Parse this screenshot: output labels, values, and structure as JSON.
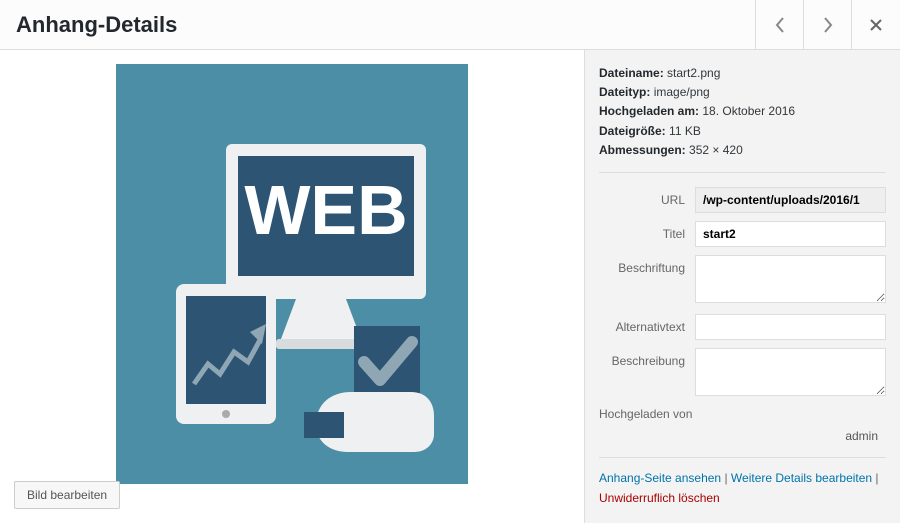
{
  "header": {
    "title": "Anhang-Details"
  },
  "edit_button": "Bild bearbeiten",
  "meta": {
    "filename_label": "Dateiname:",
    "filename_value": "start2.png",
    "filetype_label": "Dateityp:",
    "filetype_value": "image/png",
    "uploaded_on_label": "Hochgeladen am:",
    "uploaded_on_value": "18. Oktober 2016",
    "filesize_label": "Dateigröße:",
    "filesize_value": "11 KB",
    "dimensions_label": "Abmessungen:",
    "dimensions_value": "352 × 420"
  },
  "fields": {
    "url_label": "URL",
    "url_value": "/wp-content/uploads/2016/1",
    "title_label": "Titel",
    "title_value": "start2",
    "caption_label": "Beschriftung",
    "caption_value": "",
    "alt_label": "Alternativtext",
    "alt_value": "",
    "description_label": "Beschreibung",
    "description_value": ""
  },
  "uploaded_by": {
    "label": "Hochgeladen von",
    "value": "admin"
  },
  "actions": {
    "view_page": "Anhang-Seite ansehen",
    "edit_more": "Weitere Details bearbeiten",
    "delete": "Unwiderruflich löschen",
    "sep": " | "
  }
}
